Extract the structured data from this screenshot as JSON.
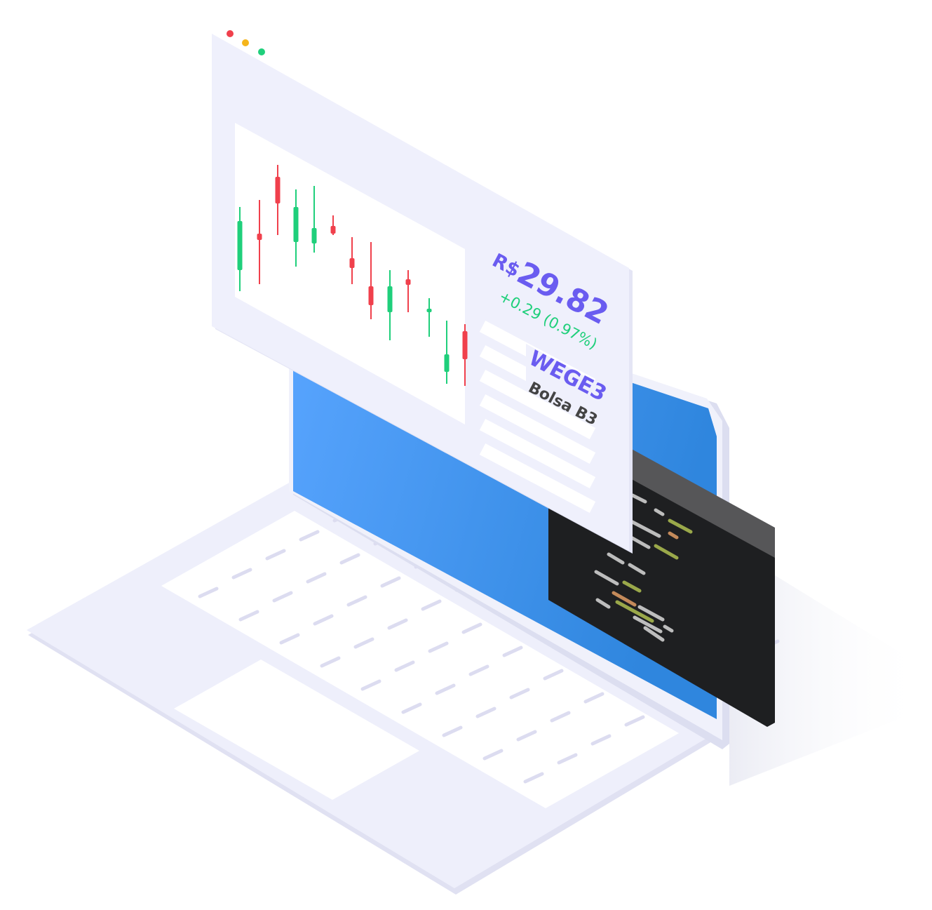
{
  "stock": {
    "currency": "R$",
    "price": "29.82",
    "change": "+0.29 (0.97%)",
    "ticker": "WEGE3",
    "exchange": "Bolsa B3"
  },
  "colors": {
    "accent": "#6a5cf0",
    "up": "#1fcf7b",
    "down": "#f0404c",
    "panel": "#eff0fc",
    "laptop_screen": "#3d8ee8",
    "terminal": "#1e1f21",
    "text_dark": "#444444"
  },
  "window_dots": [
    {
      "name": "close-dot",
      "color": "#f0404c"
    },
    {
      "name": "minimize-dot",
      "color": "#f5b51b"
    },
    {
      "name": "maximize-dot",
      "color": "#1fcf7b"
    }
  ],
  "candles": [
    {
      "dir": "up"
    },
    {
      "dir": "down"
    },
    {
      "dir": "down"
    },
    {
      "dir": "up"
    },
    {
      "dir": "up"
    },
    {
      "dir": "down"
    },
    {
      "dir": "down"
    },
    {
      "dir": "down"
    },
    {
      "dir": "up"
    },
    {
      "dir": "down"
    },
    {
      "dir": "up"
    },
    {
      "dir": "up"
    },
    {
      "dir": "down"
    }
  ]
}
